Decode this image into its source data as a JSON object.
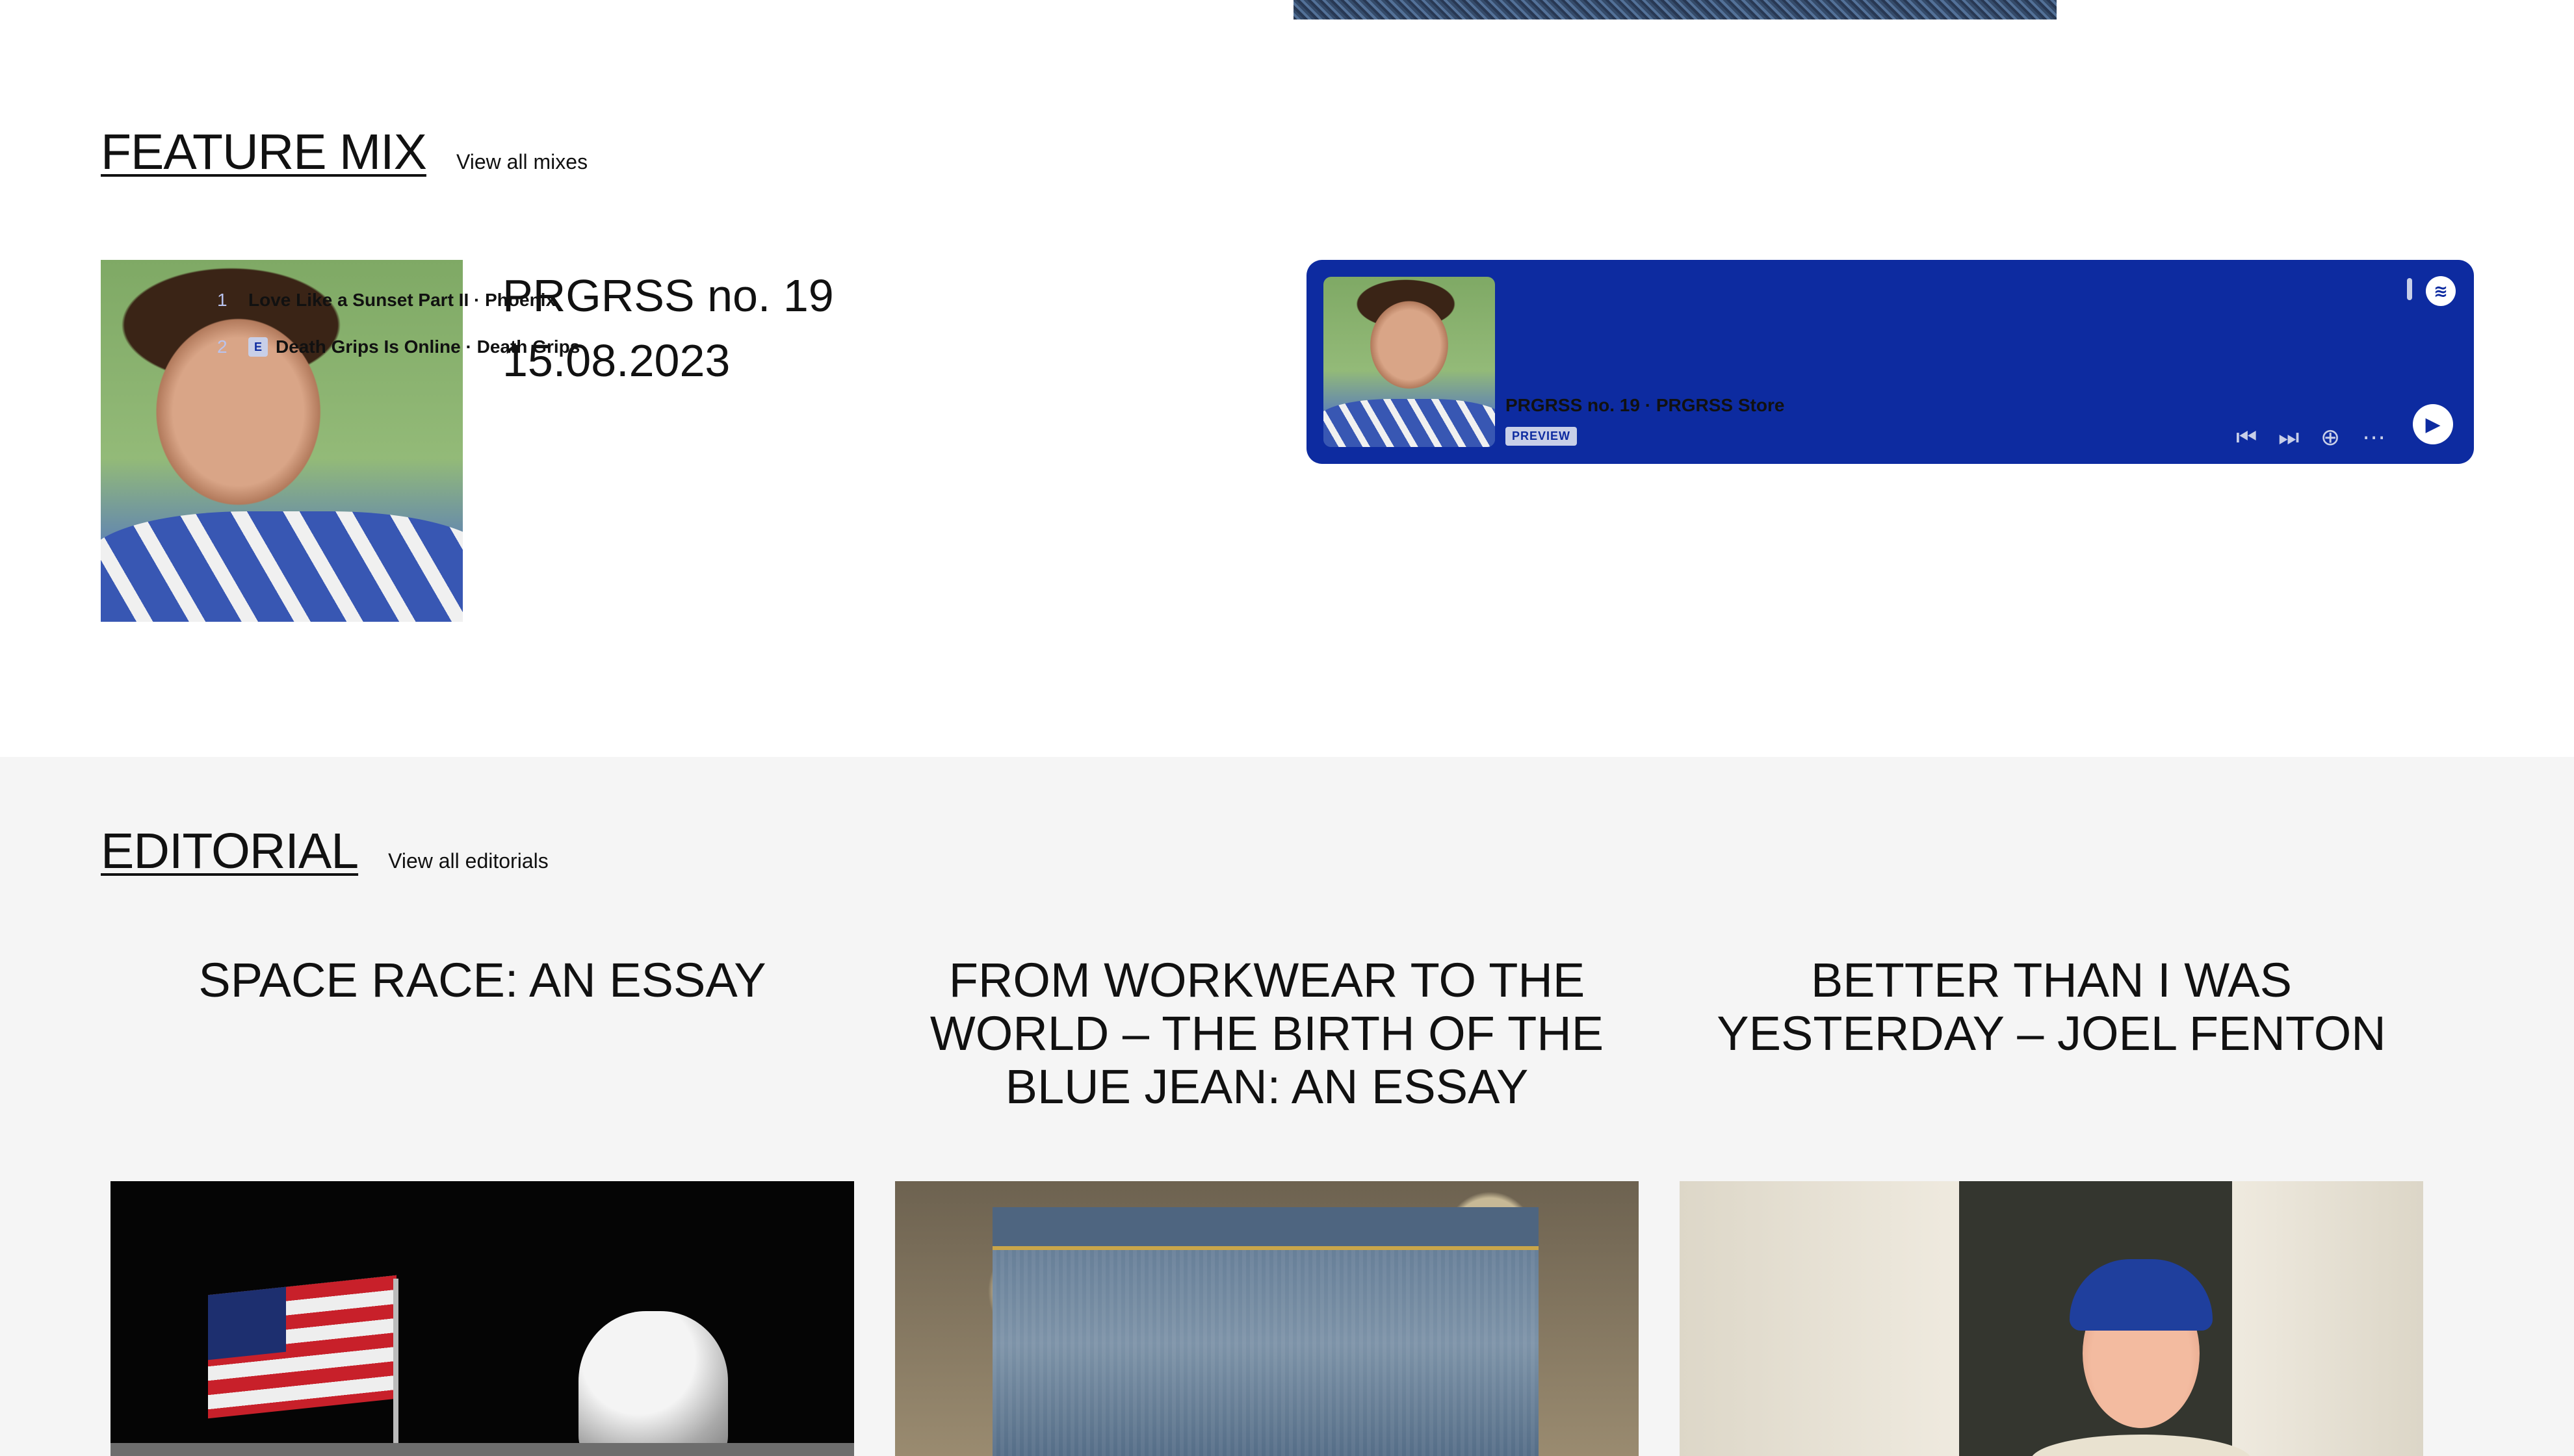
{
  "feature_mix": {
    "heading": "FEATURE MIX",
    "view_all": "View all mixes",
    "mix_title": "PRGRSS no. 19",
    "mix_date": "15.08.2023"
  },
  "spotify_embed": {
    "tracks": [
      {
        "number": "1",
        "title": "Love Like a Sunset Part II · Phoenix",
        "explicit": false
      },
      {
        "number": "2",
        "title": "Death Grips Is Online · Death Grips",
        "explicit": true,
        "explicit_label": "E"
      }
    ],
    "playlist_meta": "PRGRSS no. 19 · PRGRSS Store",
    "badge": "PREVIEW",
    "colors": {
      "background": "#0d2ba0",
      "text": "#ffffff"
    },
    "icons": [
      "spotify-icon",
      "previous-icon",
      "next-icon",
      "add-icon",
      "more-icon",
      "play-icon"
    ]
  },
  "editorial": {
    "heading": "EDITORIAL",
    "view_all": "View all editorials",
    "articles": [
      {
        "title": "SPACE RACE: AN ESSAY"
      },
      {
        "title": "FROM WORKWEAR TO THE WORLD – THE BIRTH OF THE BLUE JEAN: AN ESSAY"
      },
      {
        "title": "BETTER THAN I WAS YESTERDAY – JOEL FENTON"
      }
    ],
    "colors": {
      "background": "#f5f5f5"
    }
  }
}
